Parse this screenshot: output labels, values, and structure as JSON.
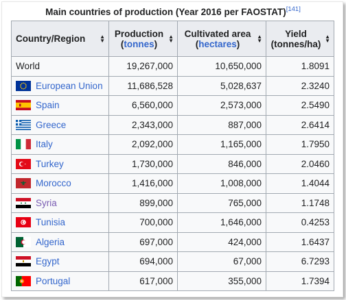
{
  "caption": "Main countries of production (Year 2016 per FAOSTAT)",
  "caption_ref": "[141]",
  "headers": {
    "country": "Country/Region",
    "production_line1": "Production",
    "production_unit": "tonnes",
    "area_line1": "Cultivated area",
    "area_unit": "hectares",
    "yield_line1": "Yield",
    "yield_line2": "(tonnes/ha)"
  },
  "rows": [
    {
      "country": "World",
      "production": "19,267,000",
      "area": "10,650,000",
      "yield": "1.8091",
      "flag": "none"
    },
    {
      "country": "European Union",
      "production": "11,686,528",
      "area": "5,028,637",
      "yield": "2.3240",
      "flag": "eu-flag-icon"
    },
    {
      "country": "Spain",
      "production": "6,560,000",
      "area": "2,573,000",
      "yield": "2.5490",
      "flag": "spain-flag-icon"
    },
    {
      "country": "Greece",
      "production": "2,343,000",
      "area": "887,000",
      "yield": "2.6414",
      "flag": "greece-flag-icon"
    },
    {
      "country": "Italy",
      "production": "2,092,000",
      "area": "1,165,000",
      "yield": "1.7950",
      "flag": "italy-flag-icon"
    },
    {
      "country": "Turkey",
      "production": "1,730,000",
      "area": "846,000",
      "yield": "2.0460",
      "flag": "turkey-flag-icon"
    },
    {
      "country": "Morocco",
      "production": "1,416,000",
      "area": "1,008,000",
      "yield": "1.4044",
      "flag": "morocco-flag-icon"
    },
    {
      "country": "Syria",
      "production": "899,000",
      "area": "765,000",
      "yield": "1.1748",
      "flag": "syria-flag-icon"
    },
    {
      "country": "Tunisia",
      "production": "700,000",
      "area": "1,646,000",
      "yield": "0.4253",
      "flag": "tunisia-flag-icon"
    },
    {
      "country": "Algeria",
      "production": "697,000",
      "area": "424,000",
      "yield": "1.6437",
      "flag": "algeria-flag-icon"
    },
    {
      "country": "Egypt",
      "production": "694,000",
      "area": "67,000",
      "yield": "6.7293",
      "flag": "egypt-flag-icon"
    },
    {
      "country": "Portugal",
      "production": "617,000",
      "area": "355,000",
      "yield": "1.7394",
      "flag": "portugal-flag-icon"
    }
  ],
  "colors": {
    "link": "#3366cc",
    "visited_link": "#795cb2",
    "header_bg": "#eaecf0",
    "cell_bg": "#f8f9fa",
    "border": "#a2a9b1"
  }
}
